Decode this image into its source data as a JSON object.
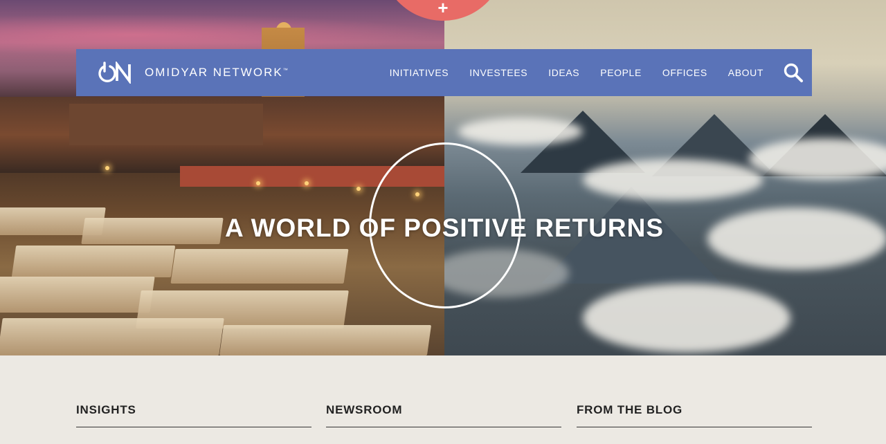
{
  "nav": {
    "logo_mark": "ON",
    "logo_text": "OMIDYAR NETWORK",
    "logo_tm": "™",
    "items": [
      {
        "label": "INITIATIVES"
      },
      {
        "label": "INVESTEES"
      },
      {
        "label": "IDEAS"
      },
      {
        "label": "PEOPLE"
      },
      {
        "label": "OFFICES"
      },
      {
        "label": "ABOUT"
      }
    ],
    "search_icon": "search-icon"
  },
  "hero": {
    "headline": "A WORLD OF POSITIVE RETURNS",
    "plus_label": "+"
  },
  "sections": [
    {
      "title": "INSIGHTS"
    },
    {
      "title": "NEWSROOM"
    },
    {
      "title": "FROM THE BLOG"
    }
  ],
  "colors": {
    "nav_bg": "#5a73b8",
    "accent": "#e86b66",
    "page_bg": "#ece9e3"
  }
}
